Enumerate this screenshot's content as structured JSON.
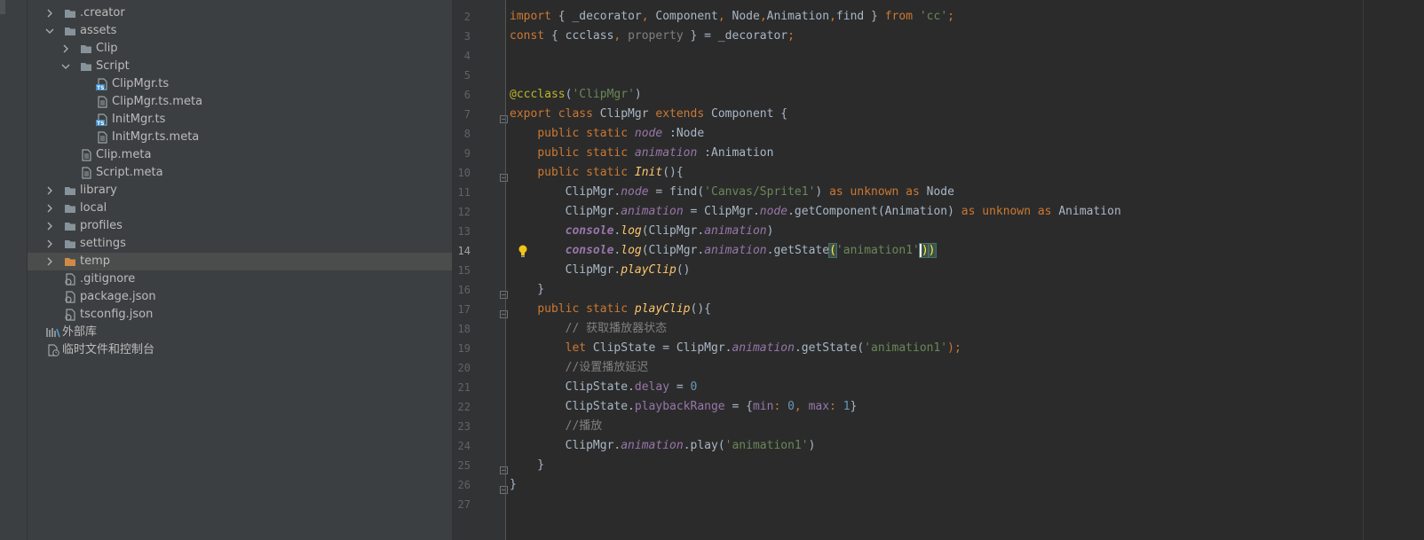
{
  "project_tree": {
    "items": [
      {
        "label": ".creator",
        "type": "folder",
        "depth": 1,
        "expanded": false
      },
      {
        "label": "assets",
        "type": "folder",
        "depth": 1,
        "expanded": true
      },
      {
        "label": "Clip",
        "type": "folder",
        "depth": 2,
        "expanded": false
      },
      {
        "label": "Script",
        "type": "folder",
        "depth": 2,
        "expanded": true
      },
      {
        "label": "ClipMgr.ts",
        "type": "ts-file",
        "depth": 3
      },
      {
        "label": "ClipMgr.ts.meta",
        "type": "file",
        "depth": 3
      },
      {
        "label": "InitMgr.ts",
        "type": "ts-file",
        "depth": 3
      },
      {
        "label": "InitMgr.ts.meta",
        "type": "file",
        "depth": 3
      },
      {
        "label": "Clip.meta",
        "type": "file",
        "depth": 2
      },
      {
        "label": "Script.meta",
        "type": "file",
        "depth": 2
      },
      {
        "label": "library",
        "type": "folder",
        "depth": 1,
        "expanded": false
      },
      {
        "label": "local",
        "type": "folder",
        "depth": 1,
        "expanded": false
      },
      {
        "label": "profiles",
        "type": "folder",
        "depth": 1,
        "expanded": false
      },
      {
        "label": "settings",
        "type": "folder",
        "depth": 1,
        "expanded": false
      },
      {
        "label": "temp",
        "type": "folder-excluded",
        "depth": 1,
        "expanded": false,
        "selected": true
      },
      {
        "label": ".gitignore",
        "type": "config-file",
        "depth": 1
      },
      {
        "label": "package.json",
        "type": "config-file",
        "depth": 1
      },
      {
        "label": "tsconfig.json",
        "type": "config-file",
        "depth": 1
      },
      {
        "label": "外部库",
        "type": "library",
        "depth": 0
      },
      {
        "label": "临时文件和控制台",
        "type": "scratch",
        "depth": 0
      }
    ]
  },
  "editor": {
    "line_numbers": [
      "2",
      "3",
      "4",
      "5",
      "6",
      "7",
      "8",
      "9",
      "10",
      "11",
      "12",
      "13",
      "14",
      "15",
      "16",
      "17",
      "18",
      "19",
      "20",
      "21",
      "22",
      "23",
      "24",
      "25",
      "26",
      "27"
    ],
    "current_line": "14",
    "tokens": {
      "l2": [
        "import",
        " { ",
        "_decorator",
        ",",
        " Component",
        ",",
        " Node",
        ",",
        "Animation",
        ",",
        "find",
        " } ",
        "from",
        " ",
        "'cc'",
        ";"
      ],
      "l3": [
        "const",
        " { ",
        "ccclass",
        ",",
        " ",
        "property",
        " } = ",
        "_decorator",
        ";"
      ],
      "l6": [
        "@ccclass",
        "(",
        "'ClipMgr'",
        ")"
      ],
      "l7": [
        "export class",
        " ClipMgr ",
        "extends",
        " Component {"
      ],
      "l8": [
        "    ",
        "public static",
        " ",
        "node",
        " :Node"
      ],
      "l9": [
        "    ",
        "public static",
        " ",
        "animation",
        " :Animation"
      ],
      "l10": [
        "    ",
        "public static",
        " ",
        "Init",
        "(){"
      ],
      "l11": [
        "        ClipMgr.",
        "node",
        " = find(",
        "'Canvas/Sprite1'",
        ") ",
        "as unknown as",
        " Node"
      ],
      "l12": [
        "        ClipMgr.",
        "animation",
        " = ClipMgr.",
        "node",
        ".getComponent(Animation) ",
        "as unknown as",
        " Animation"
      ],
      "l13": [
        "        ",
        "console",
        ".",
        "log",
        "(ClipMgr.",
        "animation",
        ")"
      ],
      "l14": [
        "        ",
        "console",
        ".",
        "log",
        "(ClipMgr.",
        "animation",
        ".getState",
        "(",
        "'animation1'",
        ")",
        ")"
      ],
      "l15": [
        "        ClipMgr.",
        "playClip",
        "()"
      ],
      "l16": [
        "    }"
      ],
      "l17": [
        "    ",
        "public static",
        " ",
        "playClip",
        "(){"
      ],
      "l18": [
        "        ",
        "// 获取播放器状态"
      ],
      "l19": [
        "        ",
        "let",
        " ClipState = ClipMgr.",
        "animation",
        ".getState(",
        "'animation1'",
        ");"
      ],
      "l20": [
        "        ",
        "//设置播放延迟"
      ],
      "l21": [
        "        ClipState.",
        "delay",
        " = ",
        "0"
      ],
      "l22": [
        "        ClipState.",
        "playbackRange",
        " = {",
        "min",
        ": ",
        "0",
        ", ",
        "max",
        ": ",
        "1",
        "}"
      ],
      "l23": [
        "        ",
        "//播放"
      ],
      "l24": [
        "        ClipMgr.",
        "animation",
        ".play(",
        "'animation1'",
        ")"
      ],
      "l25": [
        "    }"
      ],
      "l26": [
        "}"
      ]
    }
  },
  "colors": {
    "keyword": "#cc7832",
    "string": "#6a8759",
    "number": "#6897bb",
    "field": "#9876aa",
    "function": "#ffc66d",
    "annotation": "#bbb529",
    "comment": "#808080",
    "text": "#a9b7c6",
    "tree_text": "#bbbbbb",
    "folder": "#87939a",
    "folder_excluded": "#d18a45"
  }
}
